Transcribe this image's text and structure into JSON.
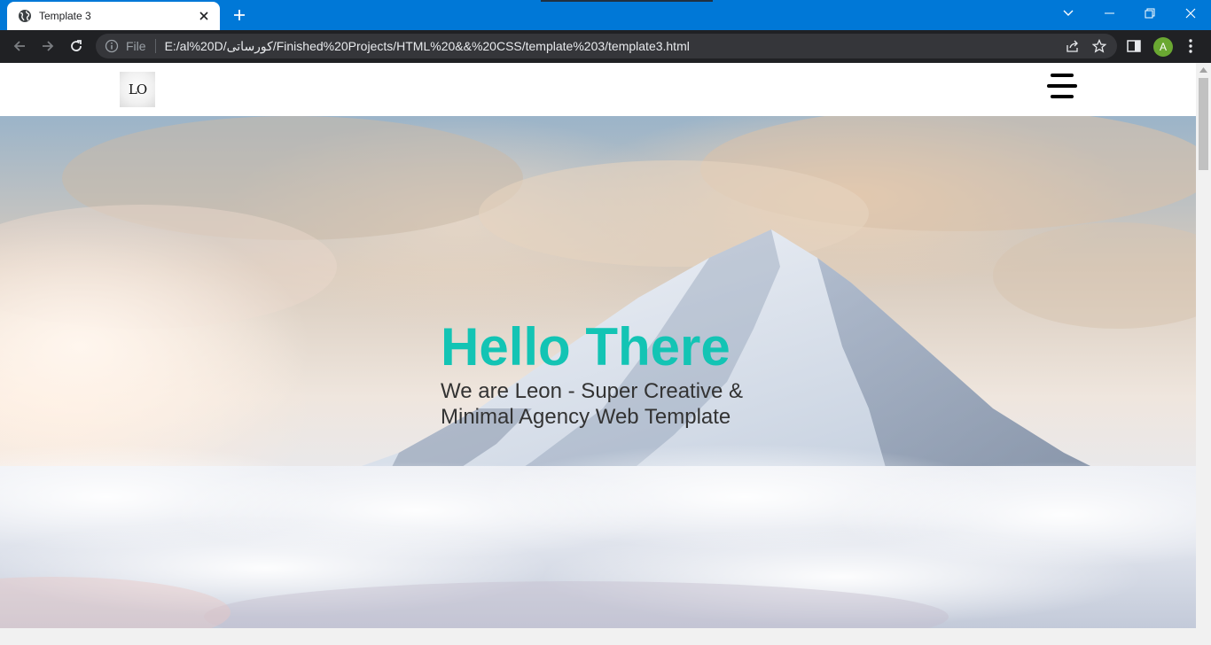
{
  "browser": {
    "tab": {
      "title": "Template 3",
      "favicon": "globe-icon",
      "close": "close-icon"
    },
    "new_tab": "plus-icon",
    "window_controls": [
      "chevron-down-icon",
      "minimize-icon",
      "restore-icon",
      "close-icon"
    ],
    "nav": [
      "back-arrow-icon",
      "forward-arrow-icon",
      "reload-icon"
    ],
    "address": {
      "scheme_label": "File",
      "url": "E:/al%20D/کورساتی/Finished%20Projects/HTML%20&&%20CSS/template%203/template3.html",
      "icons": [
        "info-icon",
        "share-icon",
        "star-icon"
      ]
    },
    "side_panel": "side-panel-icon",
    "profile_initial": "A",
    "menu": "kebab-icon"
  },
  "site": {
    "logo_text": "LO",
    "menu_icon": "hamburger-icon",
    "hero": {
      "title": "Hello There",
      "subtitle": "We are Leon - Super Creative & Minimal Agency Web Template",
      "title_color": "#13c4b4",
      "subtitle_color": "#333333"
    }
  },
  "colors": {
    "titlebar": "#0078d7",
    "toolbar": "#202124",
    "omnibox": "#35363a",
    "profile": "#6aa832"
  }
}
